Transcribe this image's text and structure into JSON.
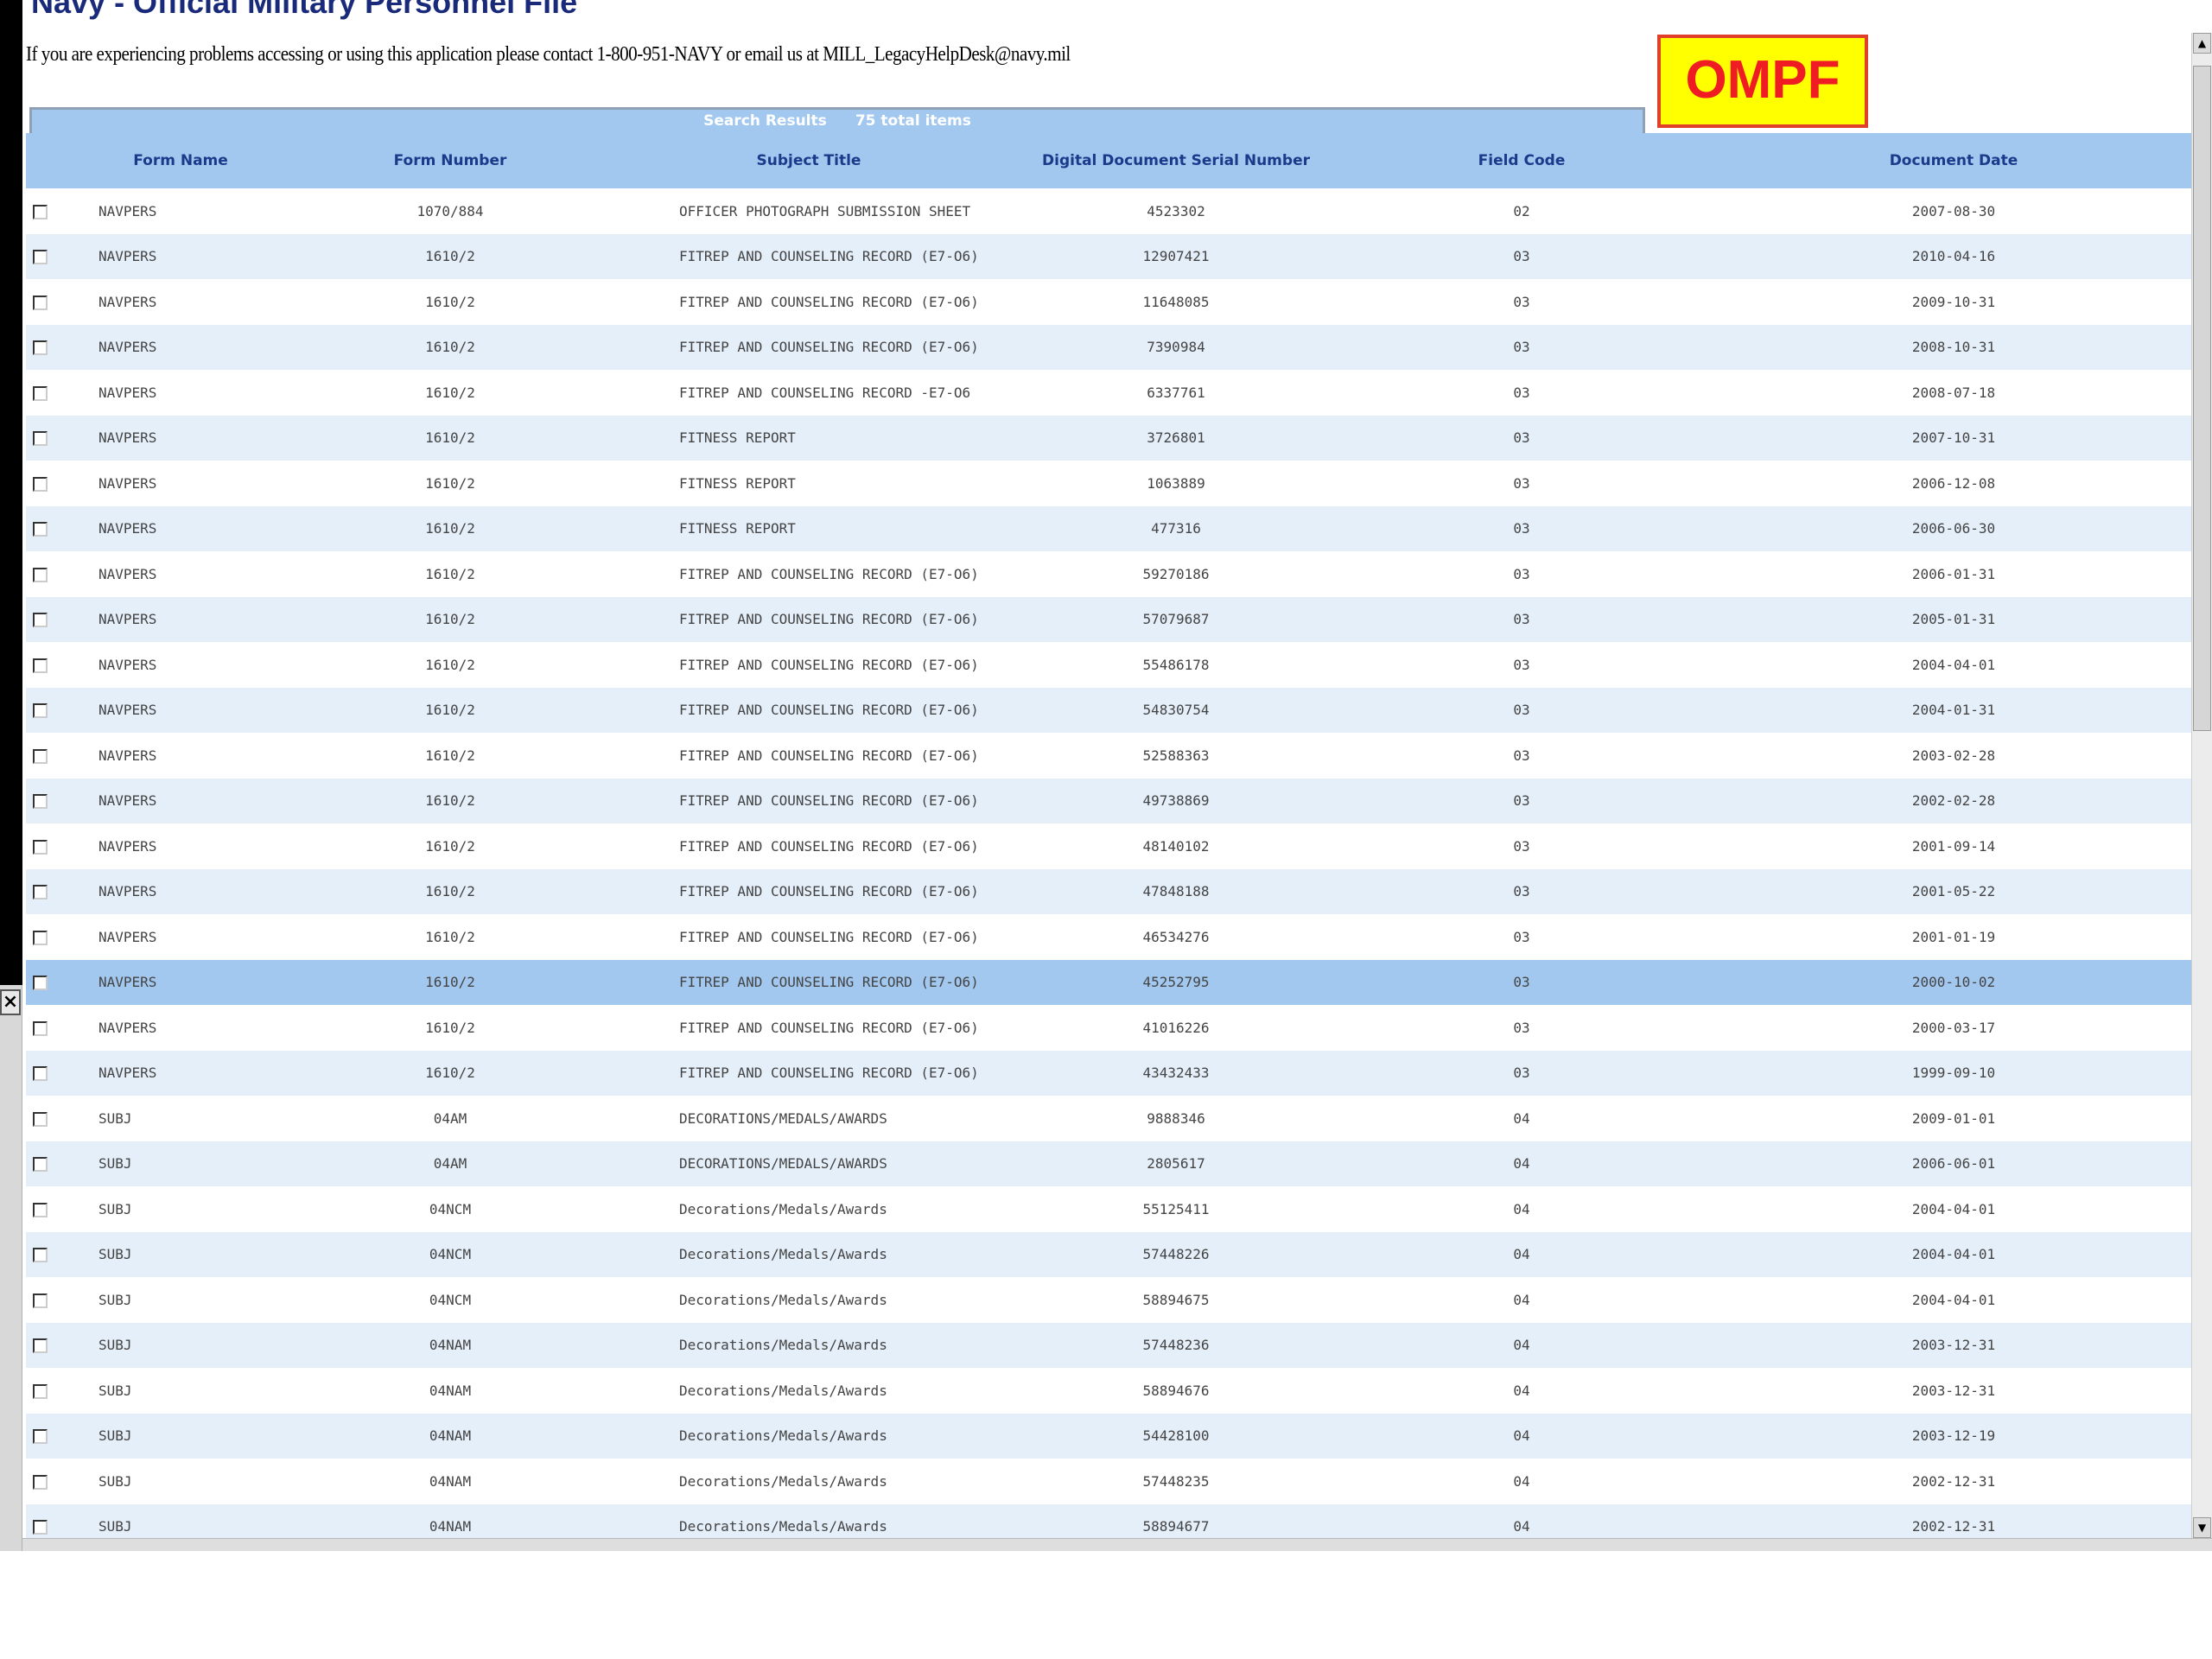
{
  "header": {
    "title": "Navy - Official Military Personnel File",
    "help_text": "If you are experiencing problems accessing or using this application please contact 1-800-951-NAVY or email us at MILL_LegacyHelpDesk@navy.mil",
    "logo_text": "OMPF"
  },
  "results": {
    "label": "Search Results",
    "count_text": "75 total items"
  },
  "table": {
    "columns": [
      "Form Name",
      "Form Number",
      "Subject Title",
      "Digital Document Serial Number",
      "Field Code",
      "Document Date"
    ],
    "rows": [
      {
        "form": "NAVPERS",
        "number": "1070/884",
        "subject": "OFFICER PHOTOGRAPH SUBMISSION SHEET",
        "serial": "4523302",
        "field": "02",
        "date": "2007-08-30"
      },
      {
        "form": "NAVPERS",
        "number": "1610/2",
        "subject": "FITREP AND COUNSELING RECORD (E7-O6)",
        "serial": "12907421",
        "field": "03",
        "date": "2010-04-16"
      },
      {
        "form": "NAVPERS",
        "number": "1610/2",
        "subject": "FITREP AND COUNSELING RECORD (E7-O6)",
        "serial": "11648085",
        "field": "03",
        "date": "2009-10-31"
      },
      {
        "form": "NAVPERS",
        "number": "1610/2",
        "subject": "FITREP AND COUNSELING RECORD (E7-O6)",
        "serial": "7390984",
        "field": "03",
        "date": "2008-10-31"
      },
      {
        "form": "NAVPERS",
        "number": "1610/2",
        "subject": "FITREP AND COUNSELING RECORD -E7-O6",
        "serial": "6337761",
        "field": "03",
        "date": "2008-07-18"
      },
      {
        "form": "NAVPERS",
        "number": "1610/2",
        "subject": "FITNESS REPORT",
        "serial": "3726801",
        "field": "03",
        "date": "2007-10-31"
      },
      {
        "form": "NAVPERS",
        "number": "1610/2",
        "subject": "FITNESS REPORT",
        "serial": "1063889",
        "field": "03",
        "date": "2006-12-08"
      },
      {
        "form": "NAVPERS",
        "number": "1610/2",
        "subject": "FITNESS REPORT",
        "serial": "477316",
        "field": "03",
        "date": "2006-06-30"
      },
      {
        "form": "NAVPERS",
        "number": "1610/2",
        "subject": "FITREP AND COUNSELING RECORD (E7-O6)",
        "serial": "59270186",
        "field": "03",
        "date": "2006-01-31"
      },
      {
        "form": "NAVPERS",
        "number": "1610/2",
        "subject": "FITREP AND COUNSELING RECORD (E7-O6)",
        "serial": "57079687",
        "field": "03",
        "date": "2005-01-31"
      },
      {
        "form": "NAVPERS",
        "number": "1610/2",
        "subject": "FITREP AND COUNSELING RECORD (E7-O6)",
        "serial": "55486178",
        "field": "03",
        "date": "2004-04-01"
      },
      {
        "form": "NAVPERS",
        "number": "1610/2",
        "subject": "FITREP AND COUNSELING RECORD (E7-O6)",
        "serial": "54830754",
        "field": "03",
        "date": "2004-01-31"
      },
      {
        "form": "NAVPERS",
        "number": "1610/2",
        "subject": "FITREP AND COUNSELING RECORD (E7-O6)",
        "serial": "52588363",
        "field": "03",
        "date": "2003-02-28"
      },
      {
        "form": "NAVPERS",
        "number": "1610/2",
        "subject": "FITREP AND COUNSELING RECORD (E7-O6)",
        "serial": "49738869",
        "field": "03",
        "date": "2002-02-28"
      },
      {
        "form": "NAVPERS",
        "number": "1610/2",
        "subject": "FITREP AND COUNSELING RECORD (E7-O6)",
        "serial": "48140102",
        "field": "03",
        "date": "2001-09-14"
      },
      {
        "form": "NAVPERS",
        "number": "1610/2",
        "subject": "FITREP AND COUNSELING RECORD (E7-O6)",
        "serial": "47848188",
        "field": "03",
        "date": "2001-05-22"
      },
      {
        "form": "NAVPERS",
        "number": "1610/2",
        "subject": "FITREP AND COUNSELING RECORD (E7-O6)",
        "serial": "46534276",
        "field": "03",
        "date": "2001-01-19"
      },
      {
        "form": "NAVPERS",
        "number": "1610/2",
        "subject": "FITREP AND COUNSELING RECORD (E7-O6)",
        "serial": "45252795",
        "field": "03",
        "date": "2000-10-02",
        "selected": true
      },
      {
        "form": "NAVPERS",
        "number": "1610/2",
        "subject": "FITREP AND COUNSELING RECORD (E7-O6)",
        "serial": "41016226",
        "field": "03",
        "date": "2000-03-17"
      },
      {
        "form": "NAVPERS",
        "number": "1610/2",
        "subject": "FITREP AND COUNSELING RECORD (E7-O6)",
        "serial": "43432433",
        "field": "03",
        "date": "1999-09-10"
      },
      {
        "form": "SUBJ",
        "number": "04AM",
        "subject": "DECORATIONS/MEDALS/AWARDS",
        "serial": "9888346",
        "field": "04",
        "date": "2009-01-01"
      },
      {
        "form": "SUBJ",
        "number": "04AM",
        "subject": "DECORATIONS/MEDALS/AWARDS",
        "serial": "2805617",
        "field": "04",
        "date": "2006-06-01"
      },
      {
        "form": "SUBJ",
        "number": "04NCM",
        "subject": "Decorations/Medals/Awards",
        "serial": "55125411",
        "field": "04",
        "date": "2004-04-01"
      },
      {
        "form": "SUBJ",
        "number": "04NCM",
        "subject": "Decorations/Medals/Awards",
        "serial": "57448226",
        "field": "04",
        "date": "2004-04-01"
      },
      {
        "form": "SUBJ",
        "number": "04NCM",
        "subject": "Decorations/Medals/Awards",
        "serial": "58894675",
        "field": "04",
        "date": "2004-04-01"
      },
      {
        "form": "SUBJ",
        "number": "04NAM",
        "subject": "Decorations/Medals/Awards",
        "serial": "57448236",
        "field": "04",
        "date": "2003-12-31"
      },
      {
        "form": "SUBJ",
        "number": "04NAM",
        "subject": "Decorations/Medals/Awards",
        "serial": "58894676",
        "field": "04",
        "date": "2003-12-31"
      },
      {
        "form": "SUBJ",
        "number": "04NAM",
        "subject": "Decorations/Medals/Awards",
        "serial": "54428100",
        "field": "04",
        "date": "2003-12-19"
      },
      {
        "form": "SUBJ",
        "number": "04NAM",
        "subject": "Decorations/Medals/Awards",
        "serial": "57448235",
        "field": "04",
        "date": "2002-12-31"
      },
      {
        "form": "SUBJ",
        "number": "04NAM",
        "subject": "Decorations/Medals/Awards",
        "serial": "58894677",
        "field": "04",
        "date": "2002-12-31"
      }
    ]
  },
  "icons": {
    "close": "×",
    "scroll_up": "▲",
    "scroll_down": "▼"
  }
}
